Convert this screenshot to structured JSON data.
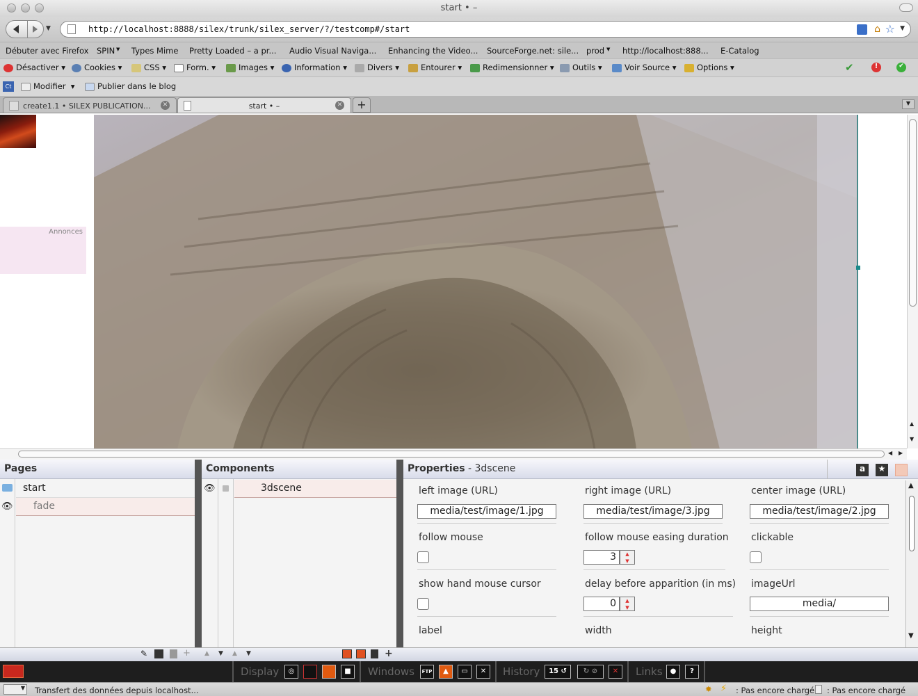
{
  "window": {
    "title": "start • –"
  },
  "toolbar": {
    "url": "http://localhost:8888/silex/trunk/silex_server/?/testcomp#/start"
  },
  "bookmarks": [
    "Débuter avec Firefox",
    "SPIN",
    "Types Mime",
    "Pretty Loaded – a pr...",
    "Audio Visual Naviga...",
    "Enhancing the Video...",
    "SourceForge.net: sile...",
    "prod",
    "http://localhost:888...",
    "E-Catalog"
  ],
  "webdev": [
    "Désactiver",
    "Cookies",
    "CSS",
    "Form.",
    "Images",
    "Information",
    "Divers",
    "Entourer",
    "Redimensionner",
    "Outils",
    "Voir Source",
    "Options"
  ],
  "blogbar": {
    "modify": "Modifier",
    "publish": "Publier dans le blog"
  },
  "tabs": [
    {
      "label": "create1.1 • SILEX PUBLICATION..."
    },
    {
      "label": "start • –"
    }
  ],
  "page": {
    "annonces": "Annonces"
  },
  "pages_panel": {
    "title": "Pages",
    "items": [
      "start",
      "fade"
    ]
  },
  "components_panel": {
    "title": "Components",
    "items": [
      "3dscene"
    ]
  },
  "properties_panel": {
    "title": "Properties",
    "subtitle": " - 3dscene",
    "fields": {
      "left_image_label": "left image (URL)",
      "left_image_value": "media/test/image/1.jpg",
      "right_image_label": "right image (URL)",
      "right_image_value": "media/test/image/3.jpg",
      "center_image_label": "center image (URL)",
      "center_image_value": "media/test/image/2.jpg",
      "follow_mouse_label": "follow mouse",
      "easing_label": "follow mouse easing duration",
      "easing_value": "3",
      "clickable_label": "clickable",
      "hand_cursor_label": "show hand mouse cursor",
      "delay_label": "delay before apparition (in ms)",
      "delay_value": "0",
      "imageurl_label": "imageUrl",
      "imageurl_value": "media/",
      "label_label": "label",
      "width_label": "width",
      "height_label": "height"
    }
  },
  "silexbar": {
    "display": "Display",
    "windows": "Windows",
    "history": "History",
    "history_count": "15",
    "links": "Links",
    "ftp": "FTP"
  },
  "statusbar": {
    "message": "Transfert des données depuis localhost...",
    "status1": ": Pas encore chargé",
    "status2": ": Pas encore chargé"
  }
}
